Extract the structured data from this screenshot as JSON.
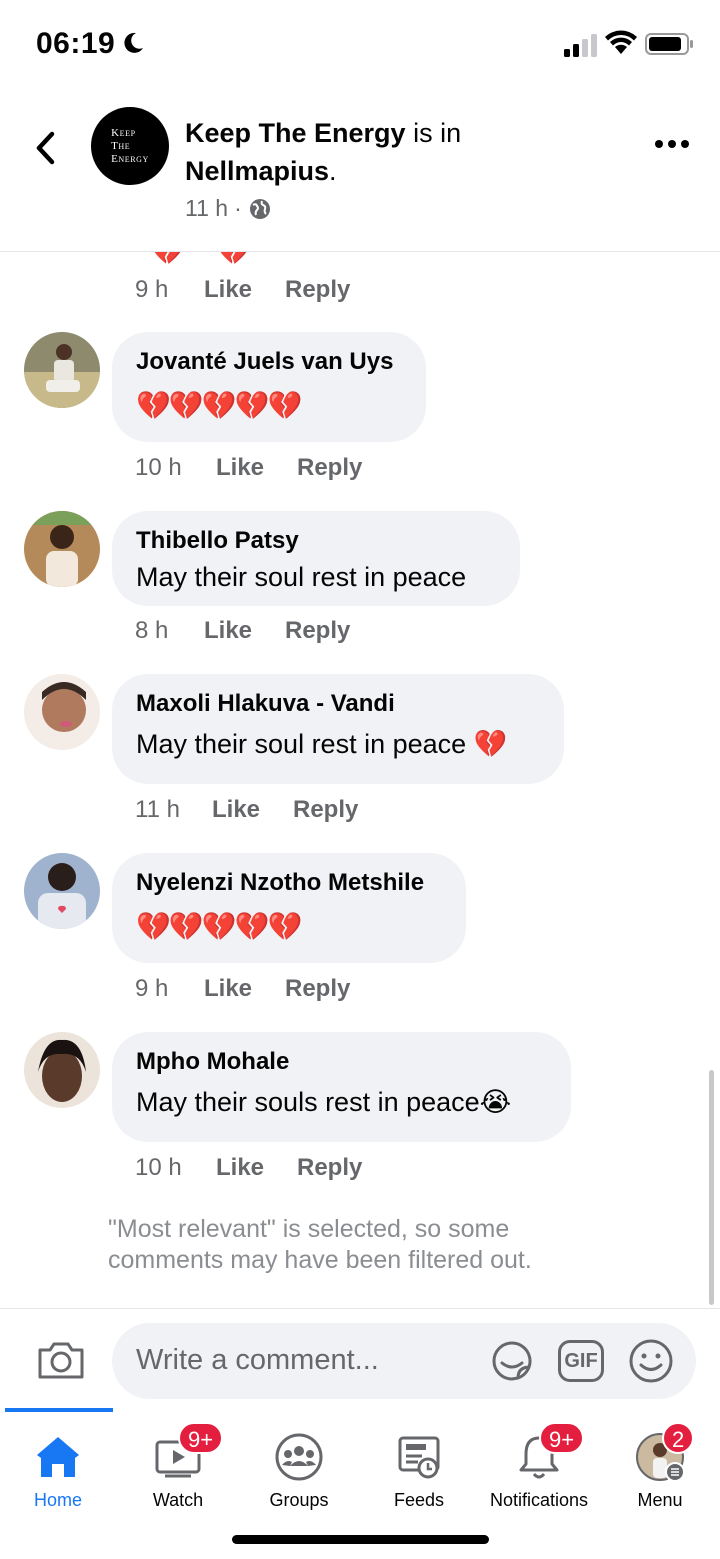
{
  "status_bar": {
    "time": "06:19"
  },
  "post_header": {
    "page_name": "Keep The Energy",
    "is_in": " is in",
    "location": "Nellmapius",
    "period": ".",
    "time": "11 h",
    "separator": "·",
    "avatar_logo_lines": [
      "Keep",
      "The",
      "Energy"
    ]
  },
  "top_partial": {
    "time": "9 h",
    "like": "Like",
    "reply": "Reply",
    "emoji": "💔"
  },
  "comments": [
    {
      "name": "Jovanté Juels van Uys",
      "emojis": "💔💔💔💔💔",
      "text": "",
      "time": "10 h",
      "like": "Like",
      "reply": "Reply"
    },
    {
      "name": "Thibello Patsy",
      "emojis": "",
      "text": "May their soul rest in peace",
      "time": "8 h",
      "like": "Like",
      "reply": "Reply"
    },
    {
      "name": "Maxoli Hlakuva - Vandi",
      "emojis": "",
      "text": "May their soul rest in peace 💔",
      "time": "11 h",
      "like": "Like",
      "reply": "Reply"
    },
    {
      "name": "Nyelenzi Nzotho Metshile",
      "emojis": "💔💔💔💔💔",
      "text": "",
      "time": "9 h",
      "like": "Like",
      "reply": "Reply"
    },
    {
      "name": "Mpho Mohale",
      "emojis": "",
      "text": "May their souls rest in peace😭",
      "time": "10 h",
      "like": "Like",
      "reply": "Reply"
    }
  ],
  "filter_note": "\"Most relevant\" is selected, so some comments may have been filtered out.",
  "composer": {
    "placeholder": "Write a comment...",
    "gif_label": "GIF"
  },
  "nav": {
    "items": [
      {
        "label": "Home",
        "badge": ""
      },
      {
        "label": "Watch",
        "badge": "9+"
      },
      {
        "label": "Groups",
        "badge": ""
      },
      {
        "label": "Feeds",
        "badge": ""
      },
      {
        "label": "Notifications",
        "badge": "9+"
      },
      {
        "label": "Menu",
        "badge": "2"
      }
    ]
  },
  "colors": {
    "accent": "#1877f2",
    "badge": "#e41e3f",
    "bubble": "#f0f2f5",
    "secondary_text": "#65676b"
  }
}
